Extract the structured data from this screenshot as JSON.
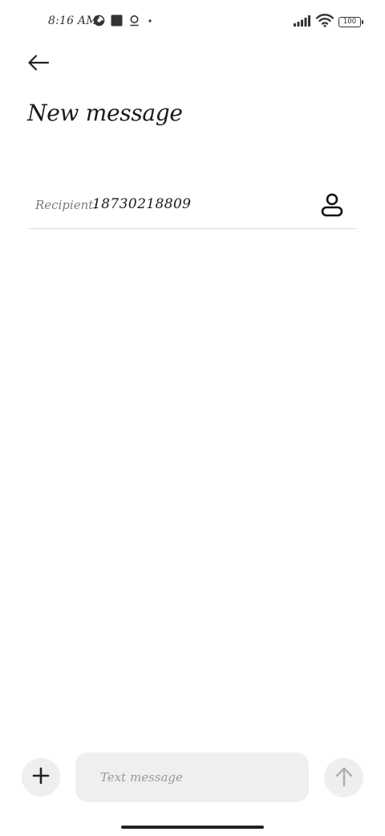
{
  "status_bar": {
    "time": "8:16 AM",
    "battery_level": "100",
    "icons": [
      "pie-chart-icon",
      "square-app-icon",
      "location-pin-icon",
      "dot-icon",
      "signal-icon",
      "wifi-icon",
      "battery-icon"
    ]
  },
  "header": {
    "back_icon": "arrow-left-icon",
    "title": "New message"
  },
  "recipient": {
    "label": "Recipient:",
    "value": "18730218809",
    "contact_icon": "person-icon"
  },
  "composer": {
    "attach_icon": "plus-icon",
    "placeholder": "Text message",
    "value": "",
    "send_icon": "arrow-up-icon"
  },
  "colors": {
    "background": "#ffffff",
    "text": "#1a1a1a",
    "muted_text": "#9a9a9a",
    "input_background": "#efefef",
    "divider": "#d9d9d9",
    "send_icon_disabled": "#b0b0b0"
  }
}
